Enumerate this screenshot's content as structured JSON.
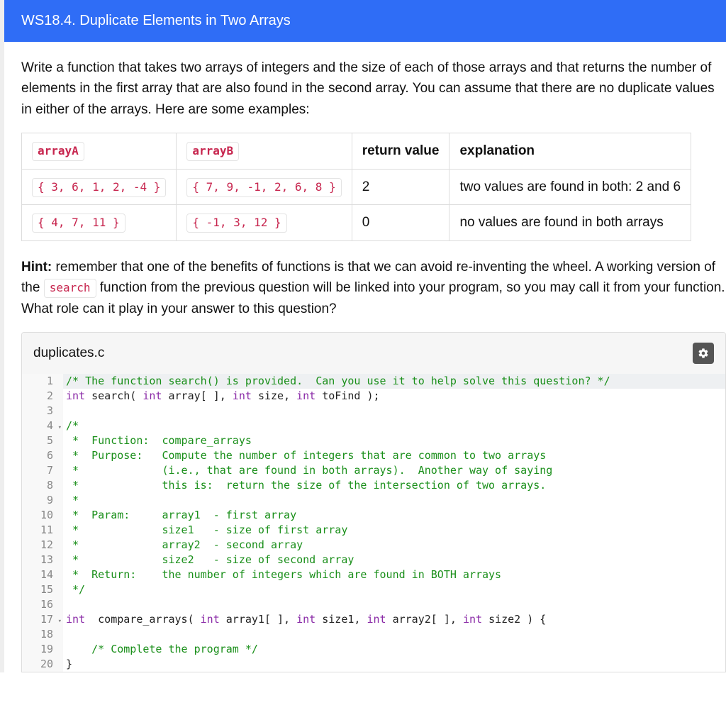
{
  "header": {
    "title": "WS18.4. Duplicate Elements in Two Arrays"
  },
  "prompt": "Write a function that takes two arrays of integers and the size of each of those arrays and that returns the number of elements in the first array that are also found in the second array. You can assume that there are no duplicate values in either of the arrays. Here are some examples:",
  "table": {
    "headers": {
      "a": "arrayA",
      "b": "arrayB",
      "ret": "return value",
      "exp": "explanation"
    },
    "rows": [
      {
        "a": "{ 3, 6, 1, 2, -4 }",
        "b": "{ 7, 9, -1, 2, 6, 8 }",
        "ret": "2",
        "exp": "two values are found in both: 2 and 6"
      },
      {
        "a": "{ 4, 7, 11 }",
        "b": "{ -1, 3, 12 }",
        "ret": "0",
        "exp": "no values are found in both arrays"
      }
    ]
  },
  "hint": {
    "label": "Hint:",
    "before": " remember that one of the benefits of functions is that we can avoid re-inventing the wheel. A working version of the ",
    "chip": "search",
    "after": " function from the previous question will be linked into your program, so you may call it from your function. What role can it play in your answer to this question?"
  },
  "editor": {
    "filename": "duplicates.c",
    "lines": [
      {
        "n": "1",
        "fold": "",
        "hl": true,
        "segs": [
          {
            "c": "tok-c",
            "t": "/* The function search() is provided.  Can you use it to help solve this question? */"
          }
        ]
      },
      {
        "n": "2",
        "fold": "",
        "hl": false,
        "segs": [
          {
            "c": "tok-k",
            "t": "int "
          },
          {
            "c": "tok-n",
            "t": "search( "
          },
          {
            "c": "tok-k",
            "t": "int "
          },
          {
            "c": "tok-n",
            "t": "array[ ], "
          },
          {
            "c": "tok-k",
            "t": "int "
          },
          {
            "c": "tok-n",
            "t": "size, "
          },
          {
            "c": "tok-k",
            "t": "int "
          },
          {
            "c": "tok-n",
            "t": "toFind );"
          }
        ]
      },
      {
        "n": "3",
        "fold": "",
        "hl": false,
        "segs": [
          {
            "c": "tok-n",
            "t": ""
          }
        ]
      },
      {
        "n": "4",
        "fold": "▾",
        "hl": false,
        "segs": [
          {
            "c": "tok-c",
            "t": "/*"
          }
        ]
      },
      {
        "n": "5",
        "fold": "",
        "hl": false,
        "segs": [
          {
            "c": "tok-c",
            "t": " *  Function:  compare_arrays"
          }
        ]
      },
      {
        "n": "6",
        "fold": "",
        "hl": false,
        "segs": [
          {
            "c": "tok-c",
            "t": " *  Purpose:   Compute the number of integers that are common to two arrays"
          }
        ]
      },
      {
        "n": "7",
        "fold": "",
        "hl": false,
        "segs": [
          {
            "c": "tok-c",
            "t": " *             (i.e., that are found in both arrays).  Another way of saying"
          }
        ]
      },
      {
        "n": "8",
        "fold": "",
        "hl": false,
        "segs": [
          {
            "c": "tok-c",
            "t": " *             this is:  return the size of the intersection of two arrays."
          }
        ]
      },
      {
        "n": "9",
        "fold": "",
        "hl": false,
        "segs": [
          {
            "c": "tok-c",
            "t": " *"
          }
        ]
      },
      {
        "n": "10",
        "fold": "",
        "hl": false,
        "segs": [
          {
            "c": "tok-c",
            "t": " *  Param:     array1  - first array"
          }
        ]
      },
      {
        "n": "11",
        "fold": "",
        "hl": false,
        "segs": [
          {
            "c": "tok-c",
            "t": " *             size1   - size of first array"
          }
        ]
      },
      {
        "n": "12",
        "fold": "",
        "hl": false,
        "segs": [
          {
            "c": "tok-c",
            "t": " *             array2  - second array"
          }
        ]
      },
      {
        "n": "13",
        "fold": "",
        "hl": false,
        "segs": [
          {
            "c": "tok-c",
            "t": " *             size2   - size of second array"
          }
        ]
      },
      {
        "n": "14",
        "fold": "",
        "hl": false,
        "segs": [
          {
            "c": "tok-c",
            "t": " *  Return:    the number of integers which are found in BOTH arrays"
          }
        ]
      },
      {
        "n": "15",
        "fold": "",
        "hl": false,
        "segs": [
          {
            "c": "tok-c",
            "t": " */"
          }
        ]
      },
      {
        "n": "16",
        "fold": "",
        "hl": false,
        "segs": [
          {
            "c": "tok-n",
            "t": ""
          }
        ]
      },
      {
        "n": "17",
        "fold": "▾",
        "hl": false,
        "segs": [
          {
            "c": "tok-k",
            "t": "int  "
          },
          {
            "c": "tok-n",
            "t": "compare_arrays( "
          },
          {
            "c": "tok-k",
            "t": "int "
          },
          {
            "c": "tok-n",
            "t": "array1[ ], "
          },
          {
            "c": "tok-k",
            "t": "int "
          },
          {
            "c": "tok-n",
            "t": "size1, "
          },
          {
            "c": "tok-k",
            "t": "int "
          },
          {
            "c": "tok-n",
            "t": "array2[ ], "
          },
          {
            "c": "tok-k",
            "t": "int "
          },
          {
            "c": "tok-n",
            "t": "size2 ) {"
          }
        ]
      },
      {
        "n": "18",
        "fold": "",
        "hl": false,
        "segs": [
          {
            "c": "tok-n",
            "t": ""
          }
        ]
      },
      {
        "n": "19",
        "fold": "",
        "hl": false,
        "segs": [
          {
            "c": "tok-n",
            "t": "    "
          },
          {
            "c": "tok-c",
            "t": "/* Complete the program */"
          }
        ]
      },
      {
        "n": "20",
        "fold": "",
        "hl": false,
        "segs": [
          {
            "c": "tok-n",
            "t": "}"
          }
        ]
      }
    ]
  }
}
